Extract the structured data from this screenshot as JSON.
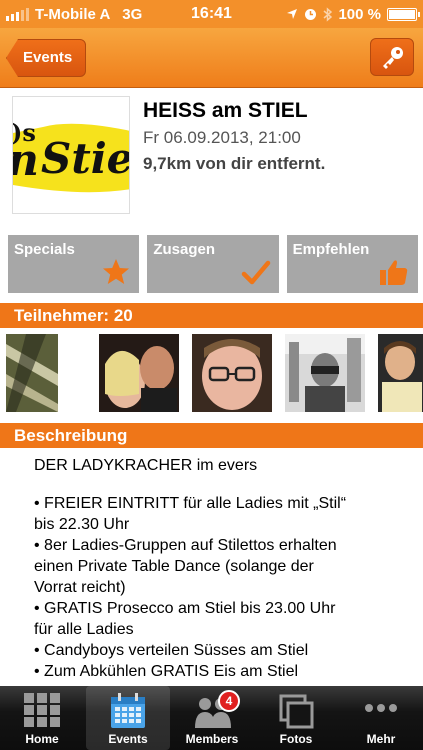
{
  "status_bar": {
    "carrier": "T-Mobile A",
    "network": "3G",
    "time": "16:41",
    "battery": "100 %"
  },
  "nav": {
    "back_label": "Events",
    "right_icon": "key-icon"
  },
  "event": {
    "title": "HEISS am STIEL",
    "date": "Fr 06.09.2013, 21:00",
    "distance": "9,7km von dir entfernt."
  },
  "actions": [
    {
      "label": "Specials",
      "icon": "star-icon"
    },
    {
      "label": "Zusagen",
      "icon": "checkmark-icon"
    },
    {
      "label": "Empfehlen",
      "icon": "thumbs-up-icon"
    }
  ],
  "participants": {
    "header": "Teilnehmer: 20"
  },
  "description": {
    "header": "Beschreibung",
    "lines": [
      "DER LADYKRACHER im evers",
      "• FREIER EINTRITT für alle Ladies mit „Stil“",
      "bis 22.30 Uhr",
      "• 8er Ladies-Gruppen auf Stilettos erhalten",
      "einen Private Table Dance (solange der",
      "Vorrat reicht)",
      "• GRATIS Prosecco am Stiel bis 23.00 Uhr",
      "für alle Ladies",
      "• Candyboys verteilen Süsses am Stiel",
      "• Zum Abkühlen GRATIS Eis am Stiel"
    ]
  },
  "tabbar": {
    "items": [
      {
        "label": "Home",
        "icon": "grid-icon"
      },
      {
        "label": "Events",
        "icon": "calendar-icon"
      },
      {
        "label": "Members",
        "icon": "members-icon",
        "badge": "4"
      },
      {
        "label": "Fotos",
        "icon": "photos-icon"
      },
      {
        "label": "Mehr",
        "icon": "more-icon"
      }
    ],
    "active": "Events"
  },
  "colors": {
    "accent": "#ef7618",
    "tile": "#a7a7a7",
    "tabbar": "#141414"
  }
}
